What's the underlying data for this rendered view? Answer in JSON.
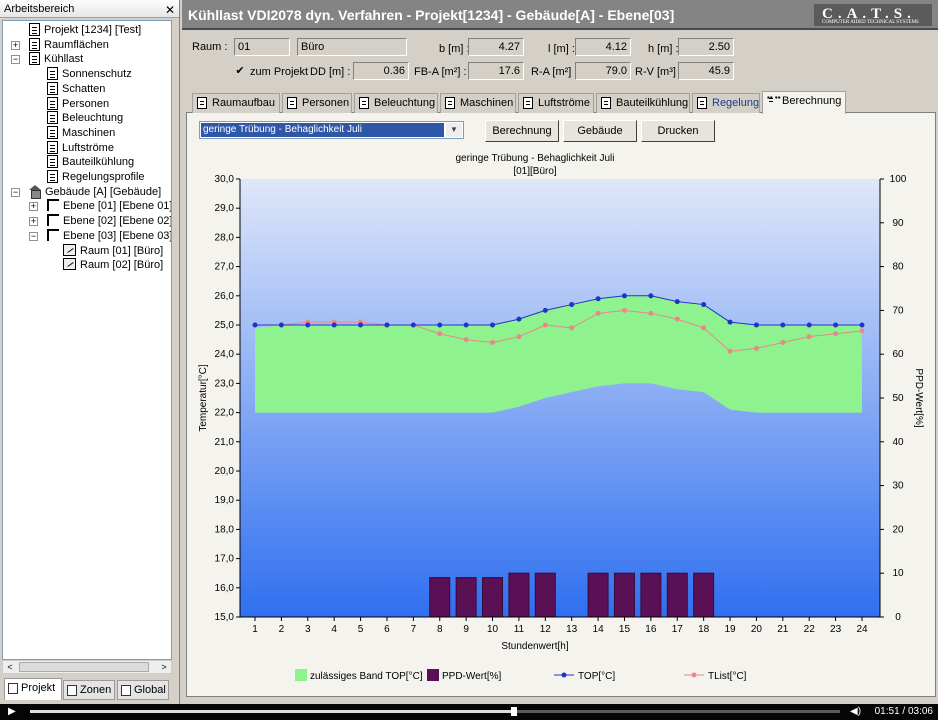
{
  "left_panel": {
    "title": "Arbeitsbereich",
    "close": "✕",
    "tree": [
      {
        "label": "Projekt [1234] [Test]",
        "icon": "doc",
        "indent": 0,
        "toggle": ""
      },
      {
        "label": "Raumflächen",
        "icon": "doc",
        "indent": 0,
        "toggle": "+"
      },
      {
        "label": "Kühllast",
        "icon": "doc",
        "indent": 0,
        "toggle": "−"
      },
      {
        "label": "Sonnenschutz",
        "icon": "doc",
        "indent": 1,
        "toggle": ""
      },
      {
        "label": "Schatten",
        "icon": "doc",
        "indent": 1,
        "toggle": ""
      },
      {
        "label": "Personen",
        "icon": "doc",
        "indent": 1,
        "toggle": ""
      },
      {
        "label": "Beleuchtung",
        "icon": "doc",
        "indent": 1,
        "toggle": ""
      },
      {
        "label": "Maschinen",
        "icon": "doc",
        "indent": 1,
        "toggle": ""
      },
      {
        "label": "Luftströme",
        "icon": "doc",
        "indent": 1,
        "toggle": ""
      },
      {
        "label": "Bauteilkühlung",
        "icon": "doc",
        "indent": 1,
        "toggle": ""
      },
      {
        "label": "Regelungsprofile",
        "icon": "doc",
        "indent": 1,
        "toggle": ""
      },
      {
        "label": "Gebäude [A] [Gebäude]",
        "icon": "house",
        "indent": 0,
        "toggle": "−"
      },
      {
        "label": "Ebene [01] [Ebene 01]",
        "icon": "level",
        "indent": 1,
        "toggle": "+"
      },
      {
        "label": "Ebene [02] [Ebene 02]",
        "icon": "level",
        "indent": 1,
        "toggle": "+"
      },
      {
        "label": "Ebene [03] [Ebene 03]",
        "icon": "level",
        "indent": 1,
        "toggle": "−"
      },
      {
        "label": "Raum [01] [Büro]",
        "icon": "room",
        "indent": 2,
        "toggle": ""
      },
      {
        "label": "Raum [02] [Büro]",
        "icon": "room",
        "indent": 2,
        "toggle": ""
      }
    ],
    "scroll_left": "<",
    "scroll_right": ">",
    "bottom_tabs": [
      "Projekt",
      "Zonen",
      "Global"
    ]
  },
  "header": {
    "title": "Kühllast VDI2078 dyn. Verfahren - Projekt[1234] - Gebäude[A] - Ebene[03]",
    "logo": "C.A.T.S.",
    "logo_sub": "COMPUTER AIDED TECHNICAL SYSTEMS"
  },
  "room": {
    "raum_label": "Raum :",
    "raum_nr": "01",
    "raum_name": "Büro",
    "zum_projekt_check": "✔",
    "zum_projekt": "zum Projekt",
    "fields": [
      {
        "label": "b [m] :",
        "value": "4.27"
      },
      {
        "label": "l [m] :",
        "value": "4.12"
      },
      {
        "label": "h [m] :",
        "value": "2.50"
      },
      {
        "label": "DD [m] :",
        "value": "0.36"
      },
      {
        "label": "FB-A [m²] :",
        "value": "17.6"
      },
      {
        "label": "R-A [m²] :",
        "value": "79.0"
      },
      {
        "label": "R-V [m³] :",
        "value": "45.9"
      }
    ]
  },
  "tabs": [
    "Raumaufbau",
    "Personen",
    "Beleuchtung",
    "Maschinen",
    "Luftströme",
    "Bauteilkühlung",
    "Regelung",
    "Berechnung"
  ],
  "active_tab_icon": "▪▪ ▪▪",
  "toolbar": {
    "combo_value": "geringe Trübung - Behaglichkeit Juli",
    "combo_arrow": "▼",
    "buttons": [
      "Berechnung",
      "Gebäude",
      "Drucken"
    ]
  },
  "colors": {
    "band": "#8ef28e",
    "ppd": "#5a1054",
    "top": "#2233cc",
    "tlist": "#e88888",
    "bg_top": "#dfe7f9",
    "bg_bottom": "#2f6ff0"
  },
  "chart_data": {
    "type": "line",
    "title": "geringe Trübung - Behaglichkeit Juli",
    "subtitle": "[01][Büro]",
    "xlabel": "Stundenwert[h]",
    "ylabel": "Temperatur[°C]",
    "y2label": "PPD-Wert[%]",
    "categories": [
      "1",
      "2",
      "3",
      "4",
      "5",
      "6",
      "7",
      "8",
      "9",
      "10",
      "11",
      "12",
      "13",
      "14",
      "15",
      "16",
      "17",
      "18",
      "19",
      "20",
      "21",
      "22",
      "23",
      "24"
    ],
    "ylim": [
      15,
      30
    ],
    "y2lim": [
      0,
      100
    ],
    "yticks": [
      "15,0",
      "16,0",
      "17,0",
      "18,0",
      "19,0",
      "20,0",
      "21,0",
      "22,0",
      "23,0",
      "24,0",
      "25,0",
      "26,0",
      "27,0",
      "28,0",
      "29,0",
      "30,0"
    ],
    "y2ticks": [
      "0",
      "10",
      "20",
      "30",
      "40",
      "50",
      "60",
      "70",
      "80",
      "90",
      "100"
    ],
    "legend_placement": "bottom",
    "series": [
      {
        "name": "zulässiges Band TOP[°C]",
        "type": "area",
        "upper": [
          24.9,
          25.0,
          25.0,
          25.0,
          25.0,
          25.0,
          25.0,
          25.0,
          25.0,
          25.0,
          25.2,
          25.5,
          25.7,
          25.9,
          26.0,
          26.0,
          25.8,
          25.7,
          25.1,
          25.0,
          25.0,
          25.0,
          25.0,
          25.0
        ],
        "lower": [
          22.0,
          22.0,
          22.0,
          22.0,
          22.0,
          22.0,
          22.0,
          22.0,
          22.0,
          22.0,
          22.2,
          22.5,
          22.7,
          22.9,
          23.0,
          23.0,
          22.8,
          22.7,
          22.1,
          22.0,
          22.0,
          22.0,
          22.0,
          22.0
        ]
      },
      {
        "name": "PPD-Wert[%]",
        "type": "bar",
        "values": [
          0,
          0,
          0,
          0,
          0,
          0,
          0,
          9,
          9,
          9,
          10,
          10,
          0,
          10,
          10,
          10,
          10,
          10,
          0,
          0,
          0,
          0,
          0,
          0
        ]
      },
      {
        "name": "TOP[°C]",
        "type": "line",
        "values": [
          25.0,
          25.0,
          25.0,
          25.0,
          25.0,
          25.0,
          25.0,
          25.0,
          25.0,
          25.0,
          25.2,
          25.5,
          25.7,
          25.9,
          26.0,
          26.0,
          25.8,
          25.7,
          25.1,
          25.0,
          25.0,
          25.0,
          25.0,
          25.0
        ]
      },
      {
        "name": "TList[°C]",
        "type": "line",
        "values": [
          25.0,
          25.0,
          25.1,
          25.1,
          25.1,
          25.0,
          25.0,
          24.7,
          24.5,
          24.4,
          24.6,
          25.0,
          24.9,
          25.4,
          25.5,
          25.4,
          25.2,
          24.9,
          24.1,
          24.2,
          24.4,
          24.6,
          24.7,
          24.8
        ]
      }
    ]
  },
  "player": {
    "play": "▶",
    "volume": "◀)",
    "time": "01:51 / 03:06",
    "progress": 0.597
  }
}
